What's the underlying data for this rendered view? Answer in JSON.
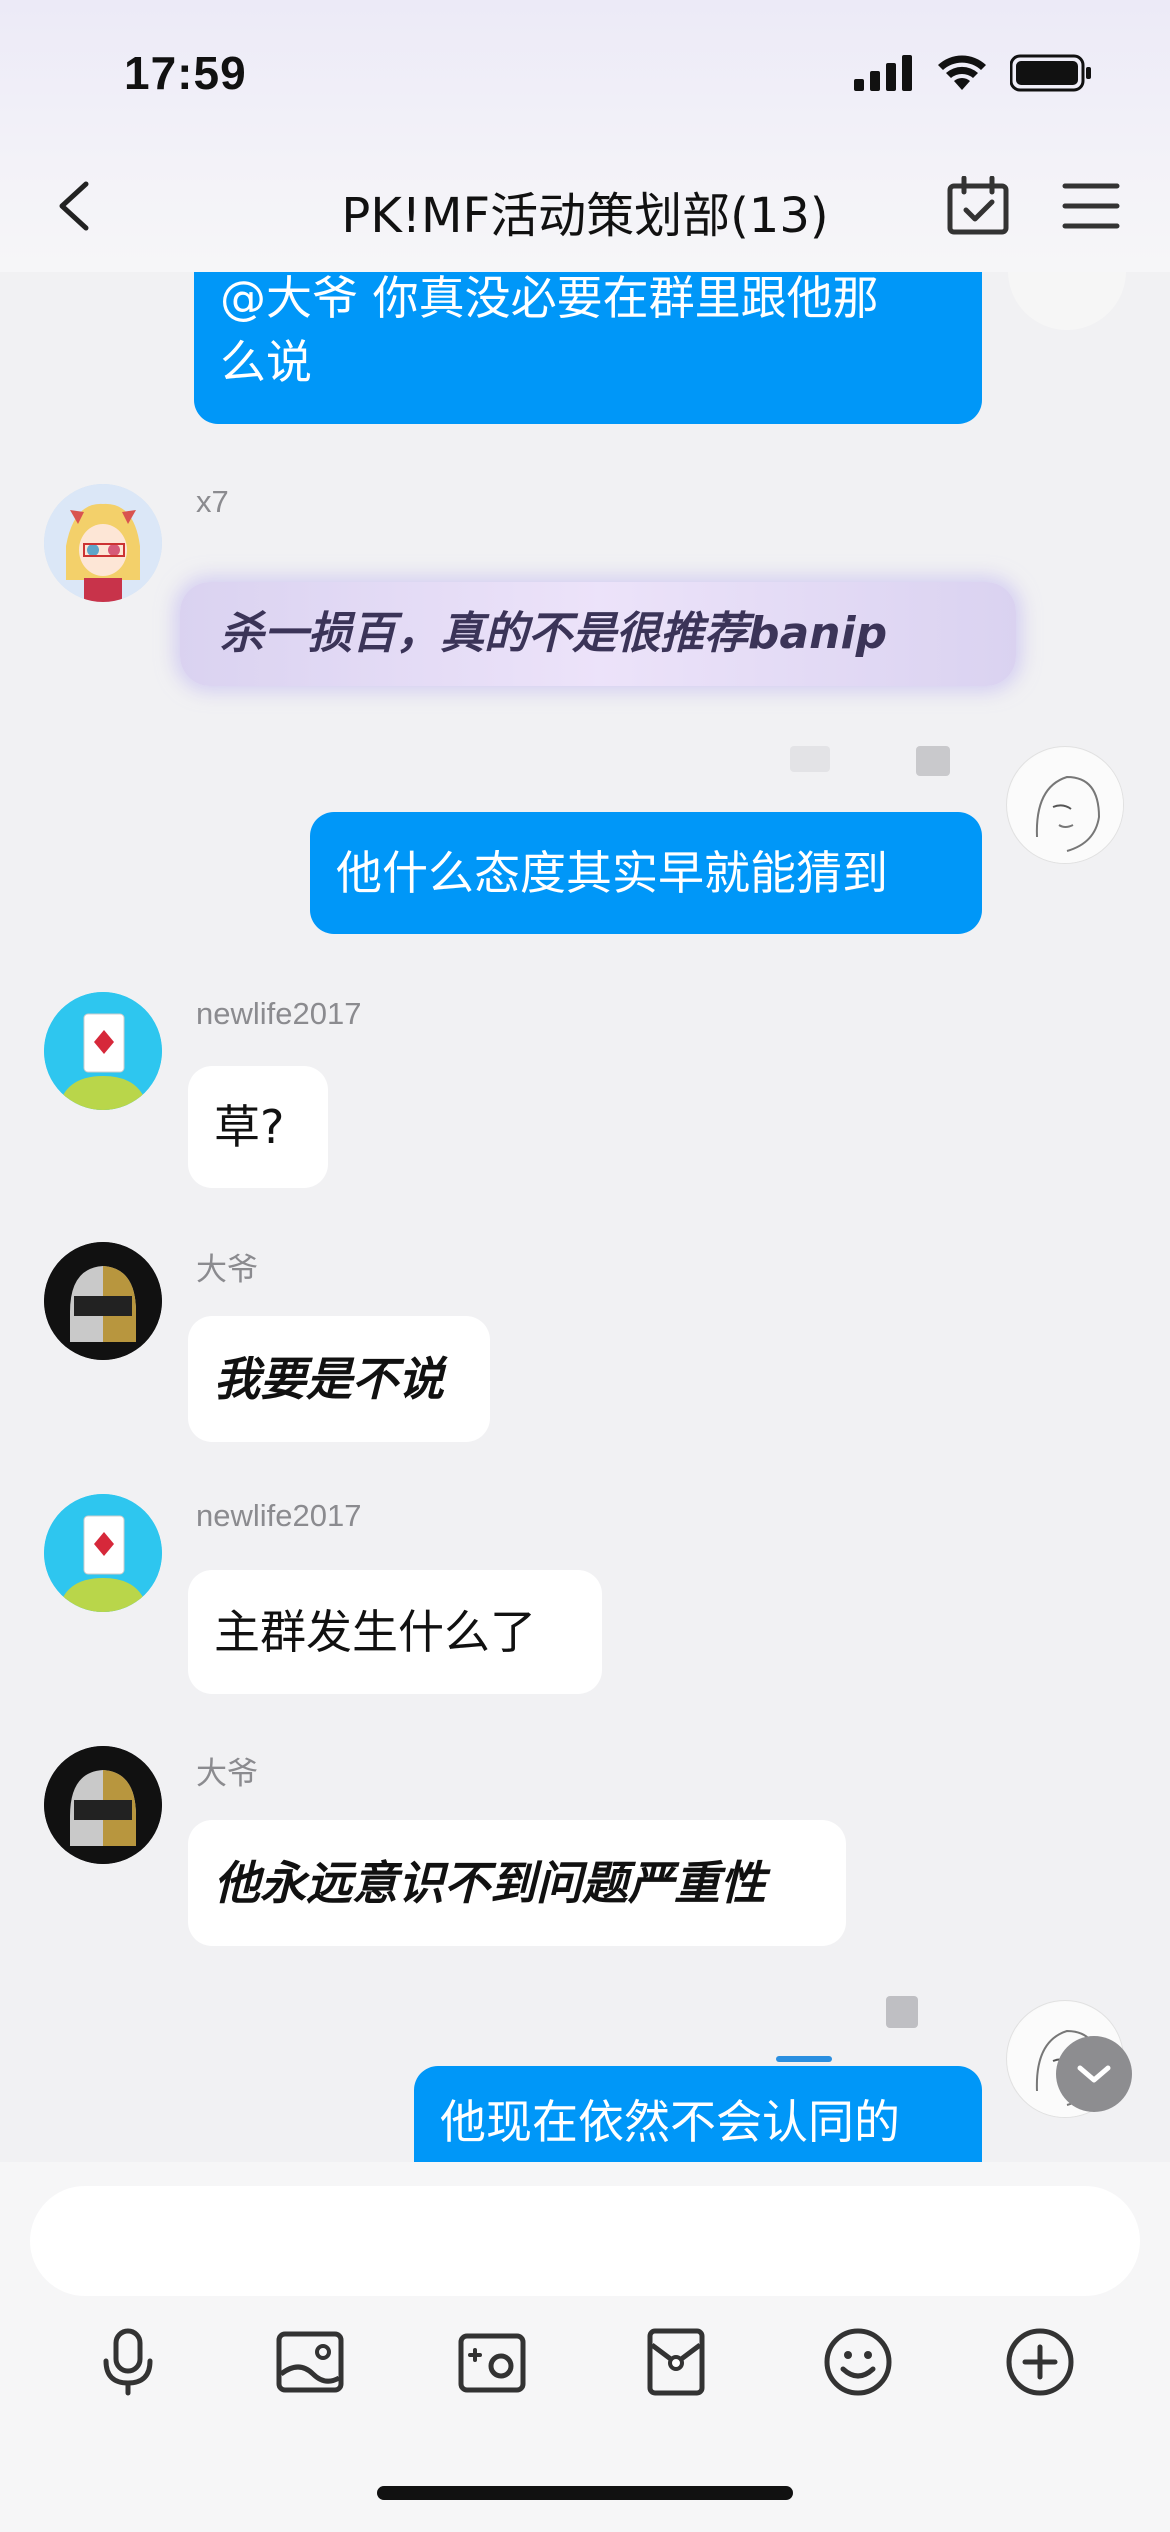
{
  "status": {
    "time": "17:59"
  },
  "header": {
    "title": "PK!MF活动策划部(13)"
  },
  "messages": [
    {
      "sender": "",
      "text": "@大爷 你真没必要在群里跟他那\n么说",
      "line1": "@大爷 你真没必要在群里跟他那",
      "line2": "么说",
      "direction": "out"
    },
    {
      "sender": "x7",
      "text": "杀一损百，真的不是很推荐banip",
      "direction": "in",
      "style": "decorated"
    },
    {
      "sender": "",
      "text": "他什么态度其实早就能猜到",
      "direction": "out"
    },
    {
      "sender": "newlife2017",
      "text": "草?",
      "direction": "in"
    },
    {
      "sender": "大爷",
      "text": "我要是不说",
      "direction": "in",
      "style": "bold-italic"
    },
    {
      "sender": "newlife2017",
      "text": "主群发生什么了",
      "direction": "in"
    },
    {
      "sender": "大爷",
      "text": "他永远意识不到问题严重性",
      "direction": "in",
      "style": "bold-italic"
    },
    {
      "sender": "",
      "text": "他现在依然不会认同的",
      "direction": "out"
    }
  ],
  "colors": {
    "out_bubble": "#0097f8",
    "in_bubble": "#ffffff",
    "background": "#f1f1f3"
  },
  "toolbar": [
    "microphone-icon",
    "image-icon",
    "camera-icon",
    "red-packet-icon",
    "emoji-icon",
    "plus-icon"
  ]
}
